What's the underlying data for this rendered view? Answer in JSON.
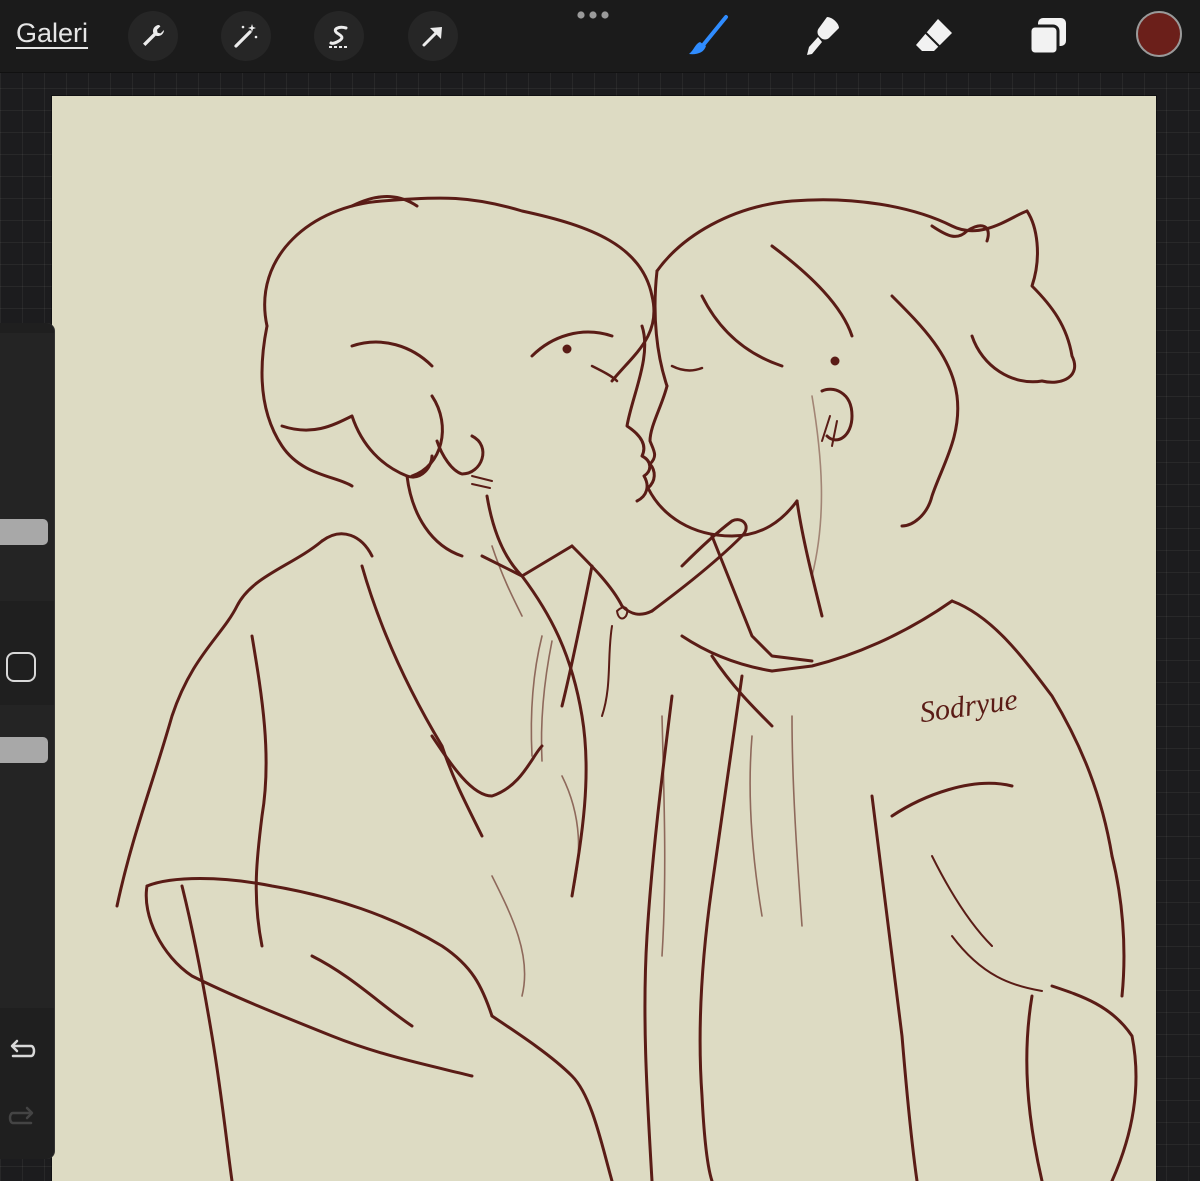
{
  "toolbar": {
    "gallery_label": "Galeri",
    "left_tools": [
      "wrench-icon",
      "magic-wand-icon",
      "selection-s-icon",
      "transform-arrow-icon"
    ],
    "more_icon": "more-dots-icon",
    "right_tools": [
      "brush-icon",
      "smudge-icon",
      "eraser-icon",
      "layers-icon"
    ],
    "active_tool": "brush",
    "active_tool_color": "#2f8cff",
    "current_color": "#6b1f1a"
  },
  "sidebar": {
    "brush_size_level": 0.4,
    "opacity_level": 0.15,
    "modify_icon": "square-modify-icon",
    "undo_icon": "undo-icon",
    "redo_icon": "redo-icon"
  },
  "canvas": {
    "background_color": "#dddbc3",
    "ink_color": "#5a1c16",
    "artwork": "sketch-couple-kissing",
    "signature_text": "Sodryue"
  }
}
